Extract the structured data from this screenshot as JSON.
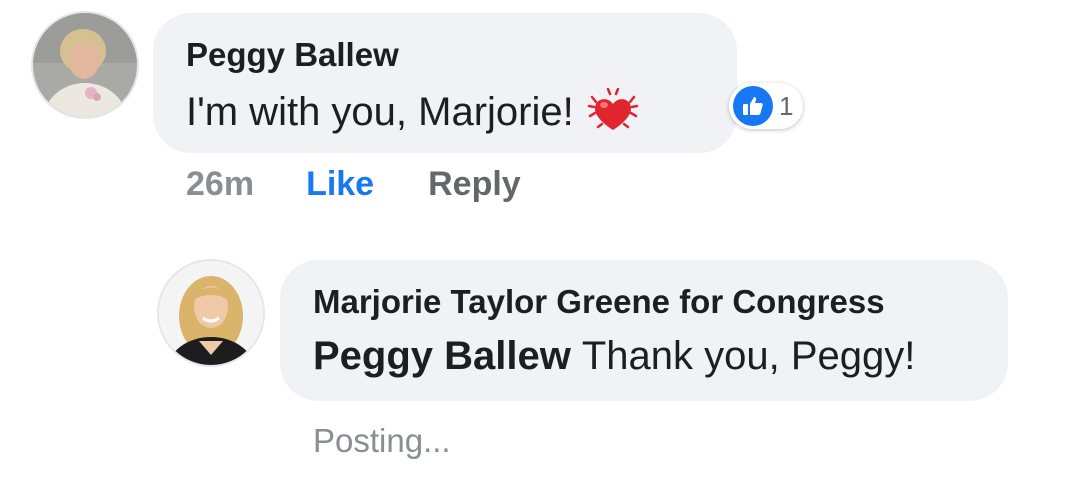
{
  "comment": {
    "author": "Peggy Ballew",
    "text": "I'm with you, Marjorie!",
    "emoji_icon": "beating-heart-icon",
    "reactions": {
      "icon": "thumbs-up-icon",
      "count": "1",
      "color": "#1877f2"
    },
    "timestamp": "26m",
    "like_label": "Like",
    "reply_label": "Reply"
  },
  "reply": {
    "author": "Marjorie Taylor Greene for Congress",
    "mention": "Peggy Ballew",
    "text": "Thank you, Peggy!",
    "status": "Posting..."
  },
  "colors": {
    "bubble": "#f0f2f5",
    "link": "#1877f2",
    "muted": "#65676b",
    "text": "#1c1e21"
  }
}
